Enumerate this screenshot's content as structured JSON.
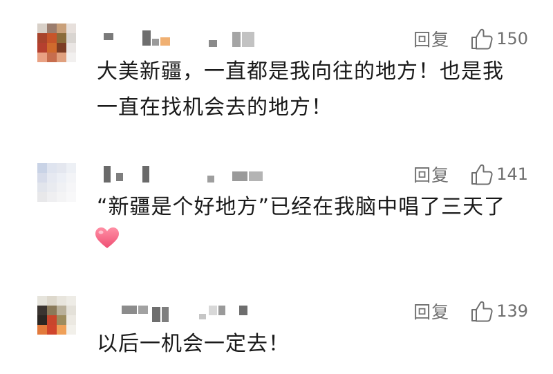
{
  "comments": [
    {
      "reply_label": "回复",
      "likes": "150",
      "text_lines": [
        "大美新疆，一直都是我向往的地方！也是我",
        "一直在找机会去的地方！"
      ],
      "avatar_colors": [
        "#d8d0c8",
        "#9b7d6e",
        "#c9a07a",
        "#e7e0dc",
        "#a8432c",
        "#c7552a",
        "#8a6b3a",
        "#d9d5d1",
        "#b5402f",
        "#d06a2d",
        "#7c3c24",
        "#eae6e4",
        "#e9a183",
        "#c76d4d",
        "#e0a07e",
        "#f2f0ef"
      ]
    },
    {
      "reply_label": "回复",
      "likes": "141",
      "text_lines": [
        "“新疆是个好地方”已经在我脑中唱了三天了"
      ],
      "emoji": "pink-heart",
      "avatar_colors": [
        "#c9d3e6",
        "#dfe4ef",
        "#e4e7ef",
        "#edf0f5",
        "#d7dcea",
        "#e6e9f1",
        "#eceff5",
        "#f3f4f7",
        "#e2e5ec",
        "#e9ebf0",
        "#f0f1f4",
        "#f6f6f8",
        "#e8e8ea",
        "#efeff1",
        "#f4f4f5",
        "#f8f8f9"
      ]
    },
    {
      "reply_label": "回复",
      "likes": "139",
      "text_lines": [
        "以后一机会一定去！"
      ],
      "avatar_colors": [
        "#e6e4dc",
        "#ddd8cc",
        "#e8e5dd",
        "#eeece6",
        "#3a3430",
        "#8a7a5a",
        "#b9b09a",
        "#e4e1d9",
        "#2b2622",
        "#c9462c",
        "#9d8c5e",
        "#ece9e2",
        "#e27a3c",
        "#d0452c",
        "#efa058",
        "#f2f0ea"
      ]
    }
  ]
}
